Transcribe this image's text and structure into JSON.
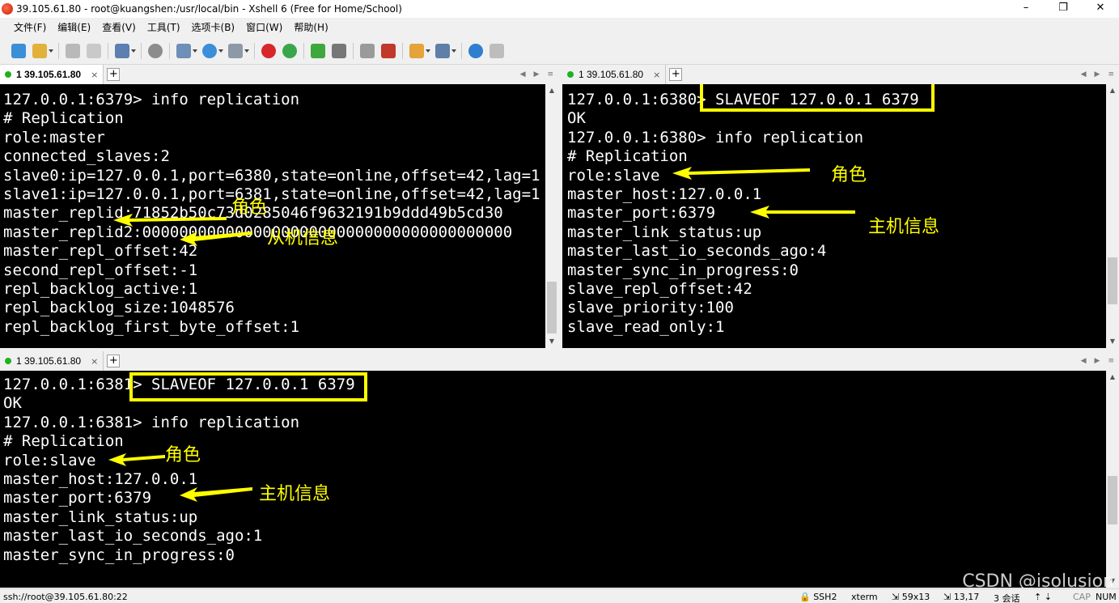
{
  "window": {
    "title": "39.105.61.80 - root@kuangshen:/usr/local/bin - Xshell 6 (Free for Home/School)",
    "minimize": "–",
    "maximize": "❐",
    "close": "✕"
  },
  "menu": [
    "文件(F)",
    "编辑(E)",
    "查看(V)",
    "工具(T)",
    "选项卡(B)",
    "窗口(W)",
    "帮助(H)"
  ],
  "toolbar_icons": [
    "new-session-icon",
    "open-folder-icon",
    "connect-icon",
    "disconnect-icon",
    "session-manager-icon",
    "find-icon",
    "transfer-icon",
    "globe-icon",
    "font-icon",
    "xftp-icon",
    "xmanager-icon",
    "fullscreen-icon",
    "lock-icon",
    "keyboard-icon",
    "highlight-icon",
    "compose-icon",
    "layout-icon",
    "help-icon",
    "chat-icon"
  ],
  "colors": {
    "terminal_bg": "#000000",
    "terminal_fg": "#ffffff",
    "annotation": "#ffff00",
    "tab_dot": "#1db31d"
  },
  "panes": {
    "top_left": {
      "tab": {
        "label": "1 39.105.61.80",
        "close": "×"
      },
      "lines": [
        "127.0.0.1:6379> info replication",
        "# Replication",
        "role:master",
        "connected_slaves:2",
        "slave0:ip=127.0.0.1,port=6380,state=online,offset=42,lag=1",
        "slave1:ip=127.0.0.1,port=6381,state=online,offset=42,lag=1",
        "master_replid:71852b50c73d0285046f9632191b9ddd49b5cd30",
        "master_replid2:0000000000000000000000000000000000000000",
        "master_repl_offset:42",
        "second_repl_offset:-1",
        "repl_backlog_active:1",
        "repl_backlog_size:1048576",
        "repl_backlog_first_byte_offset:1"
      ],
      "annotations": [
        "角色",
        "从机信息"
      ]
    },
    "top_right": {
      "tab": {
        "label": "1 39.105.61.80",
        "close": "×"
      },
      "lines": [
        "127.0.0.1:6380> SLAVEOF 127.0.0.1 6379",
        "OK",
        "127.0.0.1:6380> info replication",
        "# Replication",
        "role:slave",
        "master_host:127.0.0.1",
        "master_port:6379",
        "master_link_status:up",
        "master_last_io_seconds_ago:4",
        "master_sync_in_progress:0",
        "slave_repl_offset:42",
        "slave_priority:100",
        "slave_read_only:1"
      ],
      "annotations": [
        "角色",
        "主机信息"
      ]
    },
    "bottom": {
      "tab": {
        "label": "1 39.105.61.80",
        "close": "×"
      },
      "lines": [
        "127.0.0.1:6381> SLAVEOF 127.0.0.1 6379",
        "OK",
        "127.0.0.1:6381> info replication",
        "# Replication",
        "role:slave",
        "master_host:127.0.0.1",
        "master_port:6379",
        "master_link_status:up",
        "master_last_io_seconds_ago:1",
        "master_sync_in_progress:0"
      ],
      "annotations": [
        "角色",
        "主机信息"
      ]
    }
  },
  "statusbar": {
    "address": "ssh://root@39.105.61.80:22",
    "protocol": "SSH2",
    "terminal": "xterm",
    "size": "59x13",
    "cursor": "13,17",
    "sessions": "3 会话",
    "arrows": "⇡ ⇣",
    "caps": "CAP",
    "num": "NUM"
  },
  "watermark": "CSDN @isolusion"
}
